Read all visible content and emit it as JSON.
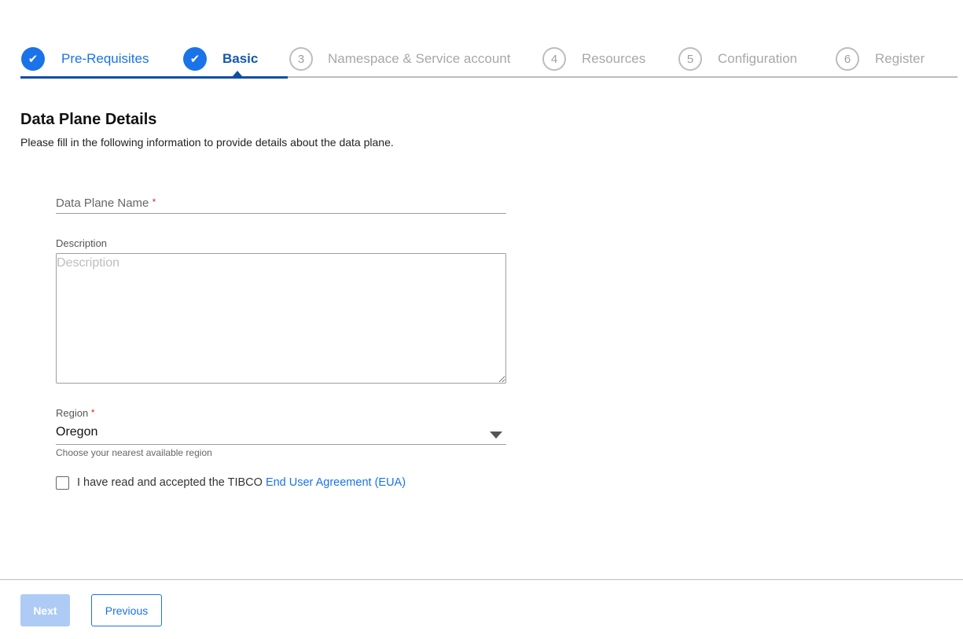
{
  "steps": [
    {
      "num": "1",
      "label": "Pre-Requisites",
      "state": "done"
    },
    {
      "num": "2",
      "label": "Basic",
      "state": "active"
    },
    {
      "num": "3",
      "label": "Namespace & Service account",
      "state": "todo"
    },
    {
      "num": "4",
      "label": "Resources",
      "state": "todo"
    },
    {
      "num": "5",
      "label": "Configuration",
      "state": "todo"
    },
    {
      "num": "6",
      "label": "Register",
      "state": "todo"
    }
  ],
  "form": {
    "title": "Data Plane Details",
    "subtitle": "Please fill in the following information to provide details about the data plane.",
    "name_label": "Data Plane Name",
    "required_mark": "*",
    "description_label": "Description",
    "description_placeholder": "Description",
    "region_label": "Region",
    "region_value": "Oregon",
    "region_hint": "Choose your nearest available region",
    "eua_text": "I have read and accepted the TIBCO ",
    "eua_link": "End User Agreement (EUA)"
  },
  "footer": {
    "next": "Next",
    "previous": "Previous"
  }
}
